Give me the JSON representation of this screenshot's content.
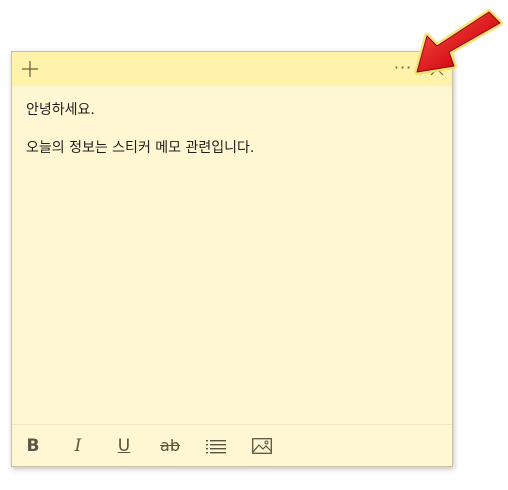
{
  "note": {
    "background": "#fff7d1",
    "titlebar_color": "#fff2ab",
    "icons": {
      "add": "plus-icon",
      "more": "more-icon",
      "close": "close-icon"
    },
    "more_label": "···",
    "lines": [
      "안녕하세요.",
      "오늘의 정보는 스티커 메모 관련입니다."
    ]
  },
  "toolbar": {
    "bold": "B",
    "italic": "I",
    "underline": "U",
    "strikethrough": "ab",
    "icons": {
      "list": "list-icon",
      "image": "image-icon"
    }
  },
  "annotation": {
    "pointer": "red-arrow",
    "color": "#e01e1e"
  }
}
